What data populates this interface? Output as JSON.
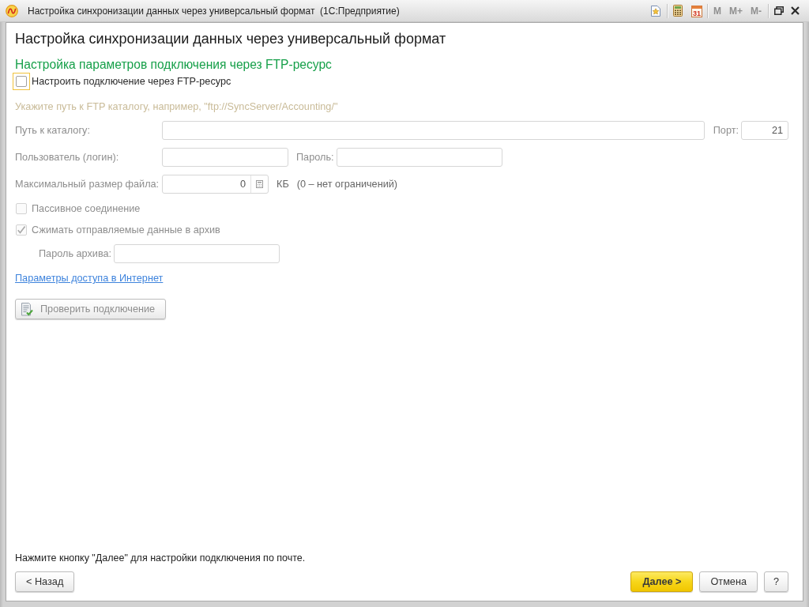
{
  "window": {
    "title": "Настройка синхронизации данных через универсальный формат  (1С:Предприятие)",
    "toolbar": [
      {
        "kind": "favorites"
      },
      {
        "kind": "calculator"
      },
      {
        "kind": "calendar",
        "label": "31"
      }
    ],
    "memory_buttons": [
      {
        "label": "M",
        "disabled": true
      },
      {
        "label": "M+",
        "disabled": true
      },
      {
        "label": "M-",
        "disabled": true
      }
    ]
  },
  "heading": "Настройка синхронизации данных через универсальный формат",
  "section": {
    "title": "Настройка параметров подключения через FTP-ресурс",
    "enable_checkbox": {
      "label": "Настроить подключение через FTP-ресурс",
      "checked": false,
      "focused": true
    }
  },
  "settings": {
    "disabled": true,
    "hint": "Укажите путь к FTP каталогу, например, \"ftp://SyncServer/Accounting/\"",
    "path": {
      "label": "Путь к каталогу:"
    },
    "port": {
      "label": "Порт:",
      "value": "21"
    },
    "user": {
      "label": "Пользователь (логин):"
    },
    "password": {
      "label": "Пароль:"
    },
    "max_file_size": {
      "label": "Максимальный размер файла:",
      "value": "0",
      "unit": "КБ",
      "note": "(0 – нет ограничений)"
    },
    "options": [
      {
        "label": "Пассивное соединение",
        "checked": false
      },
      {
        "label": "Сжимать отправляемые данные в архив",
        "checked": true
      }
    ],
    "archive_password": {
      "label": "Пароль архива:"
    },
    "internet_link": "Параметры доступа в Интернет",
    "check_button": {
      "label": "Проверить подключение"
    }
  },
  "footer": {
    "hint": "Нажмите кнопку \"Далее\" для настройки подключения по почте.",
    "buttons": [
      {
        "label": "< Назад",
        "kind": "back"
      },
      {
        "label": "Далее >",
        "kind": "next"
      },
      {
        "label": "Отмена",
        "kind": "cancel"
      },
      {
        "label": "?",
        "kind": "help"
      }
    ]
  }
}
